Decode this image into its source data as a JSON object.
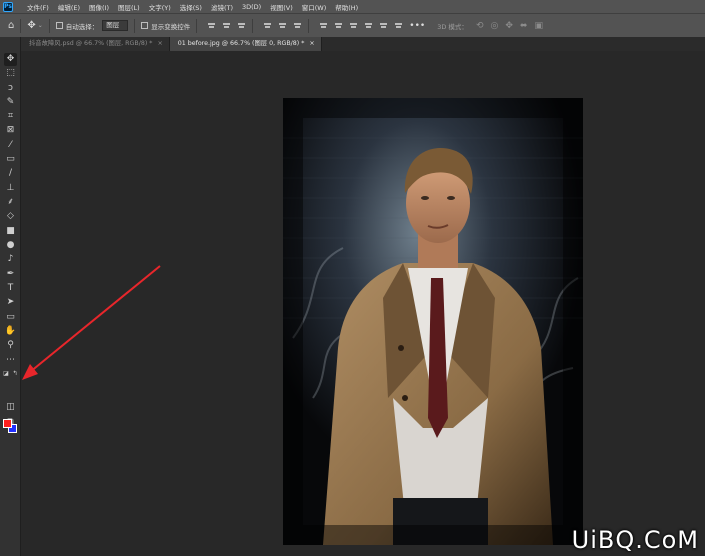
{
  "app": {
    "logo_text": "Ps"
  },
  "menu": [
    "文件(F)",
    "编辑(E)",
    "图像(I)",
    "图层(L)",
    "文字(Y)",
    "选择(S)",
    "滤镜(T)",
    "3D(D)",
    "视图(V)",
    "窗口(W)",
    "帮助(H)"
  ],
  "options": {
    "auto_select_label": "自动选择：",
    "auto_select_value": "图层",
    "transform_controls_label": "显示变换控件",
    "more_label": "•••",
    "mode_3d_label": "3D 模式："
  },
  "tabs": [
    {
      "label": "抖音故障风.psd @ 66.7% (图层, RGB/8) *",
      "active": false
    },
    {
      "label": "01 before.jpg @ 66.7% (图层 0, RGB/8) *",
      "active": true
    }
  ],
  "toolbar": {
    "tools": [
      "move",
      "marquee",
      "lasso",
      "quick-select",
      "crop",
      "frame",
      "eyedropper",
      "healing",
      "brush",
      "stamp",
      "history-brush",
      "eraser",
      "gradient",
      "blur",
      "dodge",
      "pen",
      "type",
      "path-select",
      "rectangle",
      "hand",
      "zoom",
      "more"
    ]
  },
  "colors": {
    "foreground": "#ff1e1e",
    "background": "#2330ff",
    "accent": "#31a8ff",
    "arrow": "#e8262b"
  },
  "watermark": "UiBQ.CoM"
}
